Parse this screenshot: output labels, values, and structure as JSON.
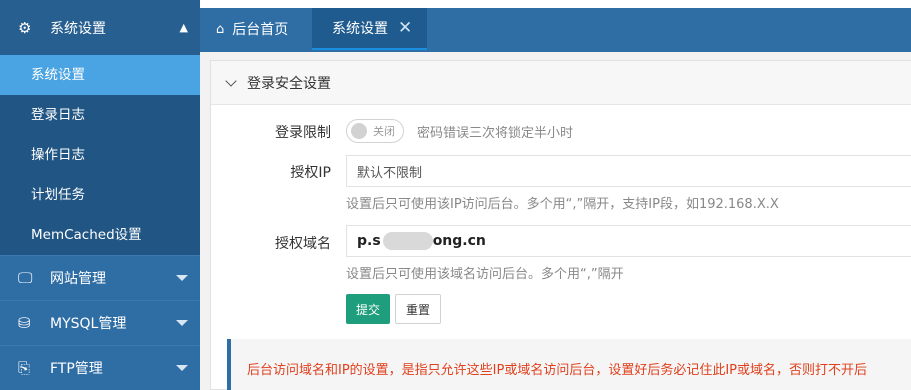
{
  "sidebar": {
    "header": {
      "icon": "gear-icon",
      "label": "系统设置",
      "arrow": "▲"
    },
    "sub_items": [
      {
        "label": "系统设置"
      },
      {
        "label": "登录日志"
      },
      {
        "label": "操作日志"
      },
      {
        "label": "计划任务"
      },
      {
        "label": "MemCached设置"
      }
    ],
    "menus": [
      {
        "icon": "monitor-icon",
        "glyph": "🖵",
        "label": "网站管理"
      },
      {
        "icon": "database-icon",
        "glyph": "⛁",
        "label": "MYSQL管理"
      },
      {
        "icon": "ftp-icon",
        "glyph": "⎘",
        "label": "FTP管理"
      }
    ]
  },
  "tabs": {
    "home": {
      "icon": "home-icon",
      "label": "后台首页"
    },
    "current": {
      "label": "系统设置",
      "close": "✕"
    }
  },
  "panel": {
    "title": "登录安全设置",
    "login_limit": {
      "label": "登录限制",
      "toggle_label": "关闭",
      "hint": "密码错误三次将锁定半小时"
    },
    "auth_ip": {
      "label": "授权IP",
      "value": "默认不限制",
      "help": "设置后只可使用该IP访问后台。多个用“,”隔开，支持IP段，如192.168.X.X"
    },
    "auth_domain": {
      "label": "授权域名",
      "value_prefix": "p.s",
      "value_suffix": "ong.cn",
      "help": "设置后只可使用该域名访问后台。多个用“,”隔开"
    },
    "buttons": {
      "submit": "提交",
      "reset": "重置"
    },
    "notice": "后台访问域名和IP的设置，是指只允许这些IP或域名访问后台，设置好后务必记住此IP或域名，否则打不开后"
  },
  "colors": {
    "sidebar": "#2f6da5",
    "sidebar_active": "#4aa3e2",
    "primary_button": "#1e9e7d",
    "notice_text": "#e0401d"
  }
}
